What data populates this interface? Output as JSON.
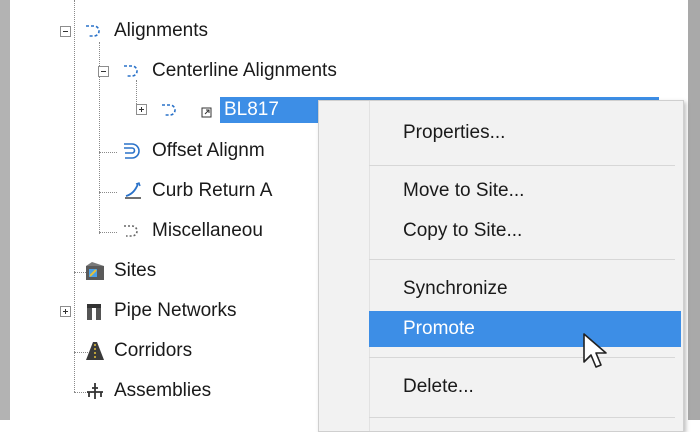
{
  "tree": {
    "items": [
      {
        "label": "Alignments",
        "icon": "alignment-icon"
      },
      {
        "label": "Centerline Alignments",
        "icon": "alignment-icon"
      },
      {
        "label": "BL817",
        "icon": "alignment-icon"
      },
      {
        "label": "Offset Alignm",
        "icon": "offset-alignment-icon"
      },
      {
        "label": "Curb Return A",
        "icon": "curb-return-icon"
      },
      {
        "label": "Miscellaneou",
        "icon": "misc-alignment-icon"
      },
      {
        "label": "Sites",
        "icon": "sites-icon"
      },
      {
        "label": "Pipe Networks",
        "icon": "pipe-network-icon"
      },
      {
        "label": "Corridors",
        "icon": "corridor-icon"
      },
      {
        "label": "Assemblies",
        "icon": "assembly-icon"
      }
    ]
  },
  "context_menu": {
    "items": [
      {
        "label": "Properties..."
      },
      {
        "label": "Move to Site..."
      },
      {
        "label": "Copy to Site..."
      },
      {
        "label": "Synchronize"
      },
      {
        "label": "Promote"
      },
      {
        "label": "Delete..."
      }
    ],
    "highlighted": "Promote"
  },
  "colors": {
    "selection": "#3d8ee6",
    "menu_bg": "#f2f2f2",
    "frame": "#b3b3b3"
  }
}
